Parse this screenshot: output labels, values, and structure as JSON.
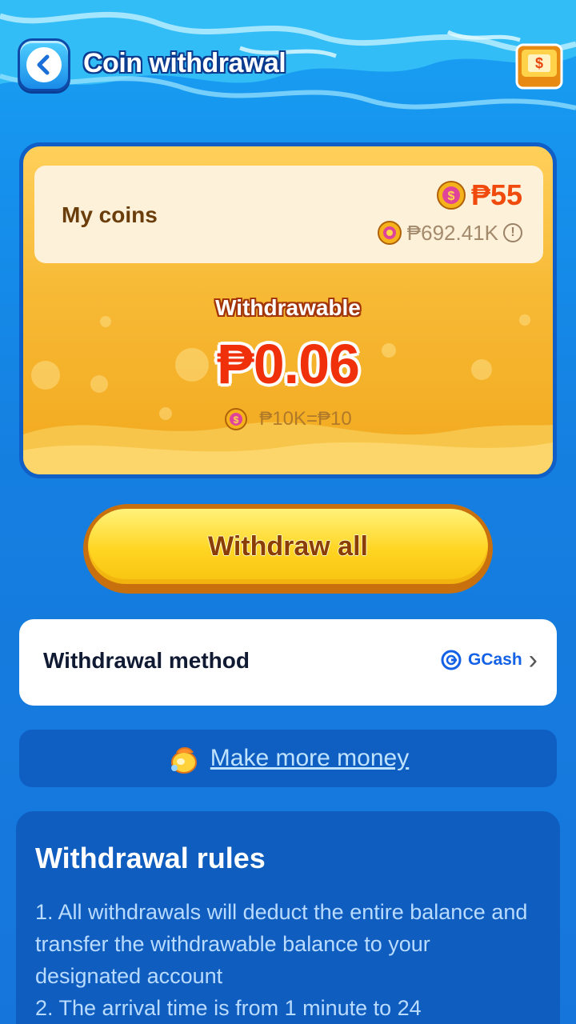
{
  "header": {
    "title": "Coin withdrawal",
    "back_icon": "chevron-left-icon",
    "wallet_icon": "wallet-dollar-icon"
  },
  "balance_card": {
    "my_coins_label": "My coins",
    "cash_value": "₱55",
    "coins_value": "₱692.41K",
    "withdrawable_label": "Withdrawable",
    "withdrawable_amount": "₱0.06",
    "exchange_rate": "₱10K=₱10"
  },
  "withdraw_button": {
    "label": "Withdraw all"
  },
  "withdrawal_method": {
    "label": "Withdrawal method",
    "provider": "GCash"
  },
  "make_more": {
    "label": "Make more money"
  },
  "rules": {
    "title": "Withdrawal rules",
    "lines": [
      "1. All withdrawals will deduct the entire balance and transfer the withdrawable balance to your designated account",
      "2. The arrival time is from 1 minute to 24"
    ]
  },
  "colors": {
    "accent_red": "#f04a0c",
    "gold": "#f7b935",
    "blue": "#1590ec"
  }
}
